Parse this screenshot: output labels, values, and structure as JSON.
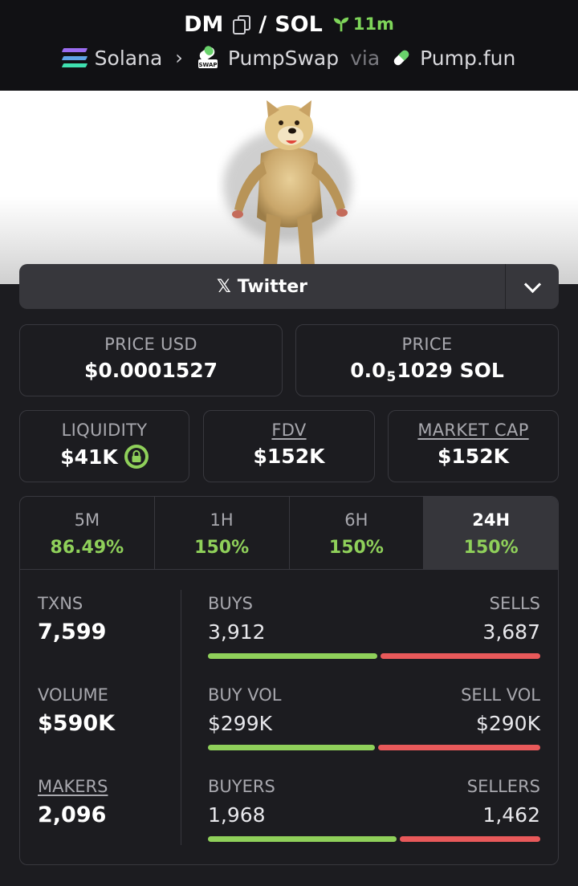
{
  "header": {
    "token": "DM",
    "pair_sep": "/",
    "quote": "SOL",
    "age": "11m",
    "chain": "Solana",
    "dex": "PumpSwap",
    "via": "via",
    "launchpad": "Pump.fun",
    "colors": {
      "age": "#7fd65a"
    }
  },
  "banner": {
    "image": "doge-image"
  },
  "social": {
    "twitter_label": "Twitter",
    "x_glyph": "𝕏"
  },
  "price": {
    "usd_label": "PRICE USD",
    "usd_value": "$0.0001527",
    "native_label": "PRICE",
    "native_prefix": "0.0",
    "native_zeros": "5",
    "native_digits": "1029 SOL"
  },
  "metrics": {
    "liquidity_label": "LIQUIDITY",
    "liquidity_value": "$41K",
    "fdv_label": "FDV",
    "fdv_value": "$152K",
    "mcap_label": "MARKET CAP",
    "mcap_value": "$152K"
  },
  "timeframes": [
    {
      "label": "5M",
      "change": "86.49%"
    },
    {
      "label": "1H",
      "change": "150%"
    },
    {
      "label": "6H",
      "change": "150%"
    },
    {
      "label": "24H",
      "change": "150%",
      "selected": true
    }
  ],
  "stats": {
    "txns_label": "TXNS",
    "txns_value": "7,599",
    "buys_label": "BUYS",
    "buys_value": "3,912",
    "sells_label": "SELLS",
    "sells_value": "3,687",
    "volume_label": "VOLUME",
    "volume_value": "$590K",
    "buy_vol_label": "BUY VOL",
    "buy_vol_value": "$299K",
    "sell_vol_label": "SELL VOL",
    "sell_vol_value": "$290K",
    "makers_label": "MAKERS",
    "makers_value": "2,096",
    "buyers_label": "BUYERS",
    "buyers_value": "1,968",
    "sellers_label": "SELLERS",
    "sellers_value": "1,462",
    "buy_share": 0.515,
    "buy_vol_share": 0.508,
    "buyer_share": 0.574
  },
  "colors": {
    "green": "#8fd05a",
    "red": "#e8595a"
  }
}
